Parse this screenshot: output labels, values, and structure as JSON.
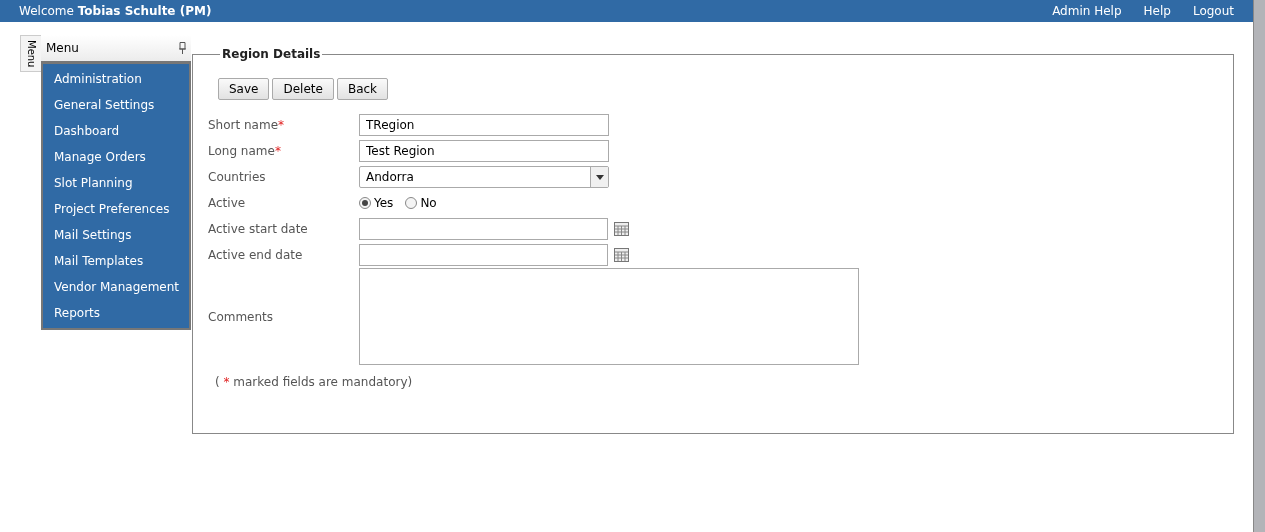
{
  "header": {
    "welcome": "Welcome",
    "user": "Tobias Schulte (PM)",
    "links": [
      "Admin Help",
      "Help",
      "Logout"
    ]
  },
  "menu": {
    "tab_label": "Menu",
    "title": "Menu",
    "items": [
      "Administration",
      "General Settings",
      "Dashboard",
      "Manage Orders",
      "Slot Planning",
      "Project Preferences",
      "Mail Settings",
      "Mail Templates",
      "Vendor Management",
      "Reports"
    ]
  },
  "form": {
    "legend": "Region Details",
    "buttons": [
      "Save",
      "Delete",
      "Back"
    ],
    "fields": [
      {
        "kind": "text",
        "label": "Short name",
        "required_mark": "*",
        "value": "TRegion"
      },
      {
        "kind": "text",
        "label": "Long name",
        "required_mark": "*",
        "value": "Test Region"
      },
      {
        "kind": "select",
        "label": "Countries",
        "value": "Andorra"
      },
      {
        "kind": "radio",
        "label": "Active",
        "options": [
          {
            "label": "Yes",
            "selected": true
          },
          {
            "label": "No",
            "selected": false
          }
        ]
      },
      {
        "kind": "date",
        "label": "Active start date"
      },
      {
        "kind": "date",
        "label": "Active end date"
      },
      {
        "kind": "textarea",
        "label": "Comments"
      }
    ],
    "note": {
      "before": "( ",
      "mark": "*",
      "after": " marked fields are mandatory)"
    }
  }
}
